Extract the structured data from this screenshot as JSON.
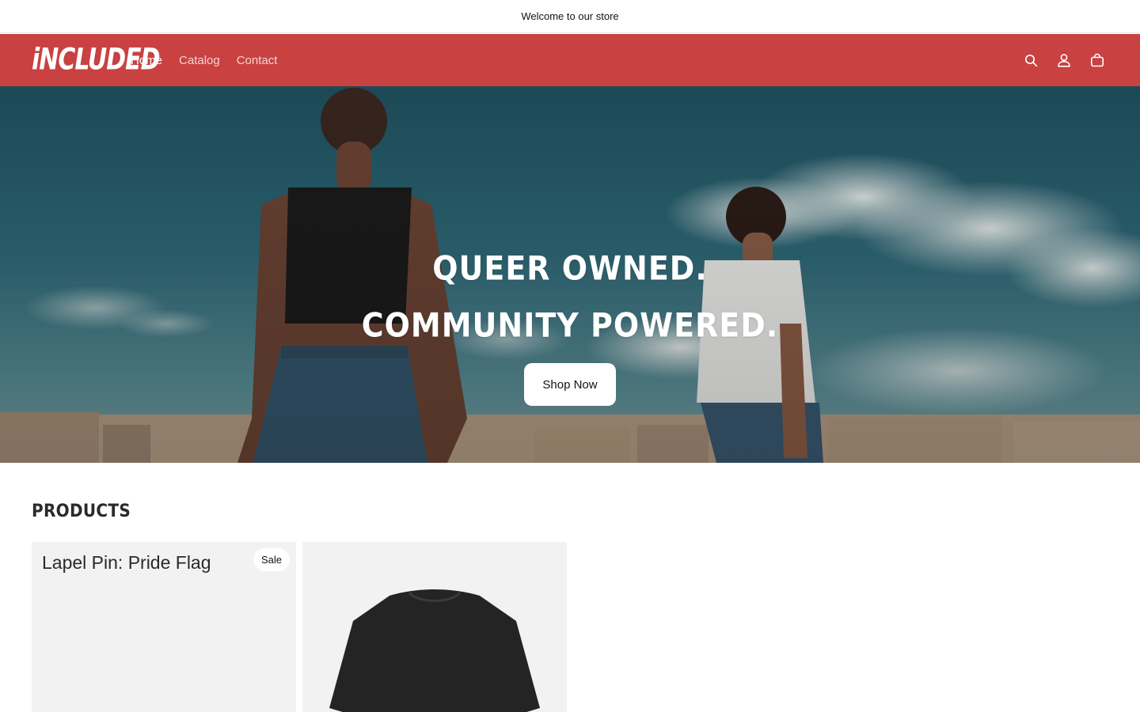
{
  "announcement": {
    "text": "Welcome to our store"
  },
  "header": {
    "logo_text": "iNCLUDED",
    "nav": [
      {
        "label": "Home",
        "active": true
      },
      {
        "label": "Catalog",
        "active": false
      },
      {
        "label": "Contact",
        "active": false
      }
    ],
    "icons": [
      "search-icon",
      "account-icon",
      "cart-icon"
    ],
    "background_color": "#c94141"
  },
  "hero": {
    "title_line1": "QUEER OWNED.",
    "title_line2": "COMMUNITY POWERED.",
    "cta_label": "Shop Now"
  },
  "products": {
    "heading": "PRODUCTS",
    "items": [
      {
        "title": "Lapel Pin: Pride Flag",
        "badge": "Sale"
      },
      {
        "title": "",
        "badge": ""
      }
    ]
  }
}
